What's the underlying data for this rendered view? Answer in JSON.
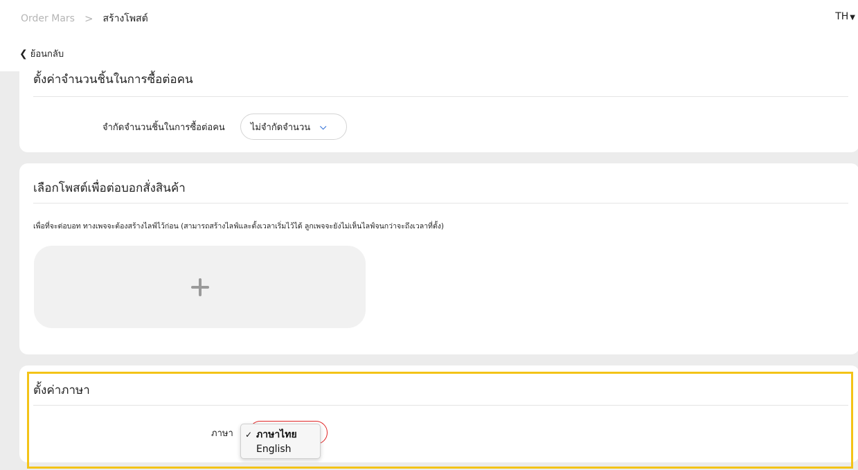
{
  "header": {
    "breadcrumb_root": "Order Mars",
    "breadcrumb_separator": ">",
    "breadcrumb_current": "สร้างโพสต์",
    "language_switch": "TH",
    "back_label": "ย้อนกลับ"
  },
  "limit_section": {
    "title": "ตั้งค่าจำนวนชิ้นในการซื้อต่อคน",
    "label": "จำกัดจำนวนชิ้นในการซื้อต่อคน",
    "select_value": "ไม่จำกัดจำนวน"
  },
  "post_section": {
    "title": "เลือกโพสต์เพื่อต่อบอกสั่งสินค้า",
    "description": "เพื่อที่จะต่อบอท ทางเพจจะต้องสร้างไลฟ์ไว้ก่อน (สามารถสร้างไลฟ์และตั้งเวลาเริ่มไว้ได้ ลูกเพจจะยังไม่เห็นไลฟ์จนกว่าจะถึงเวลาที่ตั้ง)"
  },
  "language_section": {
    "title": "ตั้งค่าภาษา",
    "label": "ภาษา",
    "options": [
      {
        "check": "✓",
        "label": "ภาษาไทย"
      },
      {
        "check": "",
        "label": "English"
      }
    ]
  },
  "icons": {
    "breadcrumb_separator": "chevron-right-icon",
    "back": "chevron-left-icon",
    "language_caret": "caret-down-icon",
    "select_caret": "chevron-down-icon",
    "add": "plus-icon",
    "selected": "checkmark-icon"
  },
  "colors": {
    "page_background": "#ececec",
    "card_background": "#ffffff",
    "accent_blue": "#2f6fd6",
    "error_red": "#e02424",
    "highlight_yellow": "#f3c317",
    "muted_text": "#b5b5b5"
  }
}
